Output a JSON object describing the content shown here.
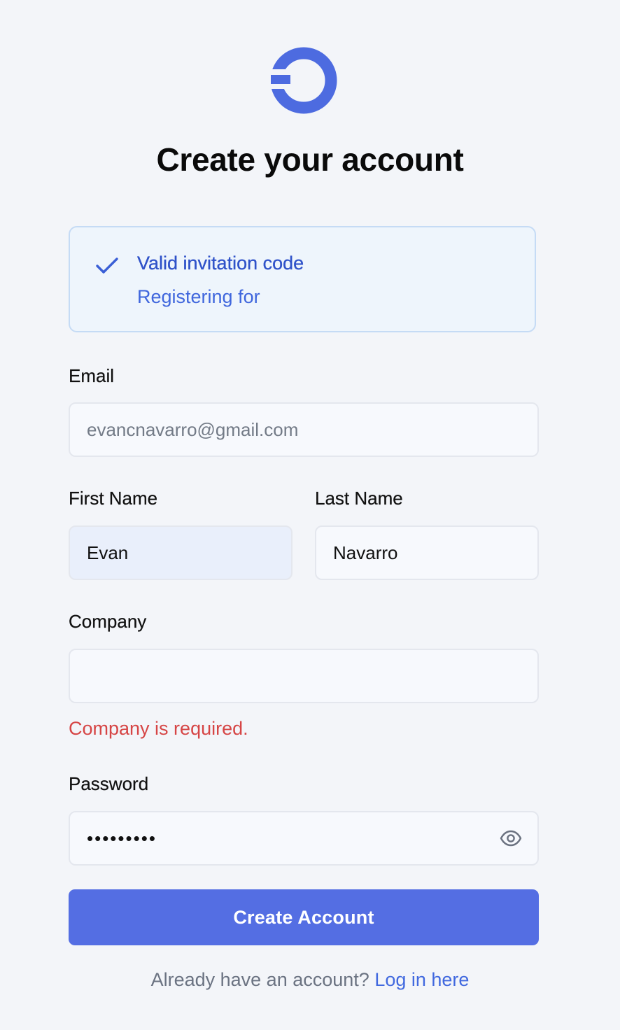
{
  "brand": {
    "logo_icon": "circle-logo-icon",
    "accent_color": "#4d6be0"
  },
  "page": {
    "title": "Create your account"
  },
  "invitation": {
    "icon": "check-icon",
    "title": "Valid invitation code",
    "subtitle": "Registering for"
  },
  "form": {
    "email": {
      "label": "Email",
      "value": "evancnavarro@gmail.com"
    },
    "first_name": {
      "label": "First Name",
      "value": "Evan"
    },
    "last_name": {
      "label": "Last Name",
      "value": "Navarro"
    },
    "company": {
      "label": "Company",
      "value": "",
      "error": "Company is required."
    },
    "password": {
      "label": "Password",
      "value": "•••••••••",
      "toggle_icon": "eye-icon"
    },
    "submit_label": "Create Account"
  },
  "footer": {
    "prompt": "Already have an account?",
    "link_label": "Log in here"
  },
  "colors": {
    "primary_button": "#546ee3",
    "error": "#d64545",
    "info_bg": "#eef5fc",
    "link": "#4169df"
  }
}
